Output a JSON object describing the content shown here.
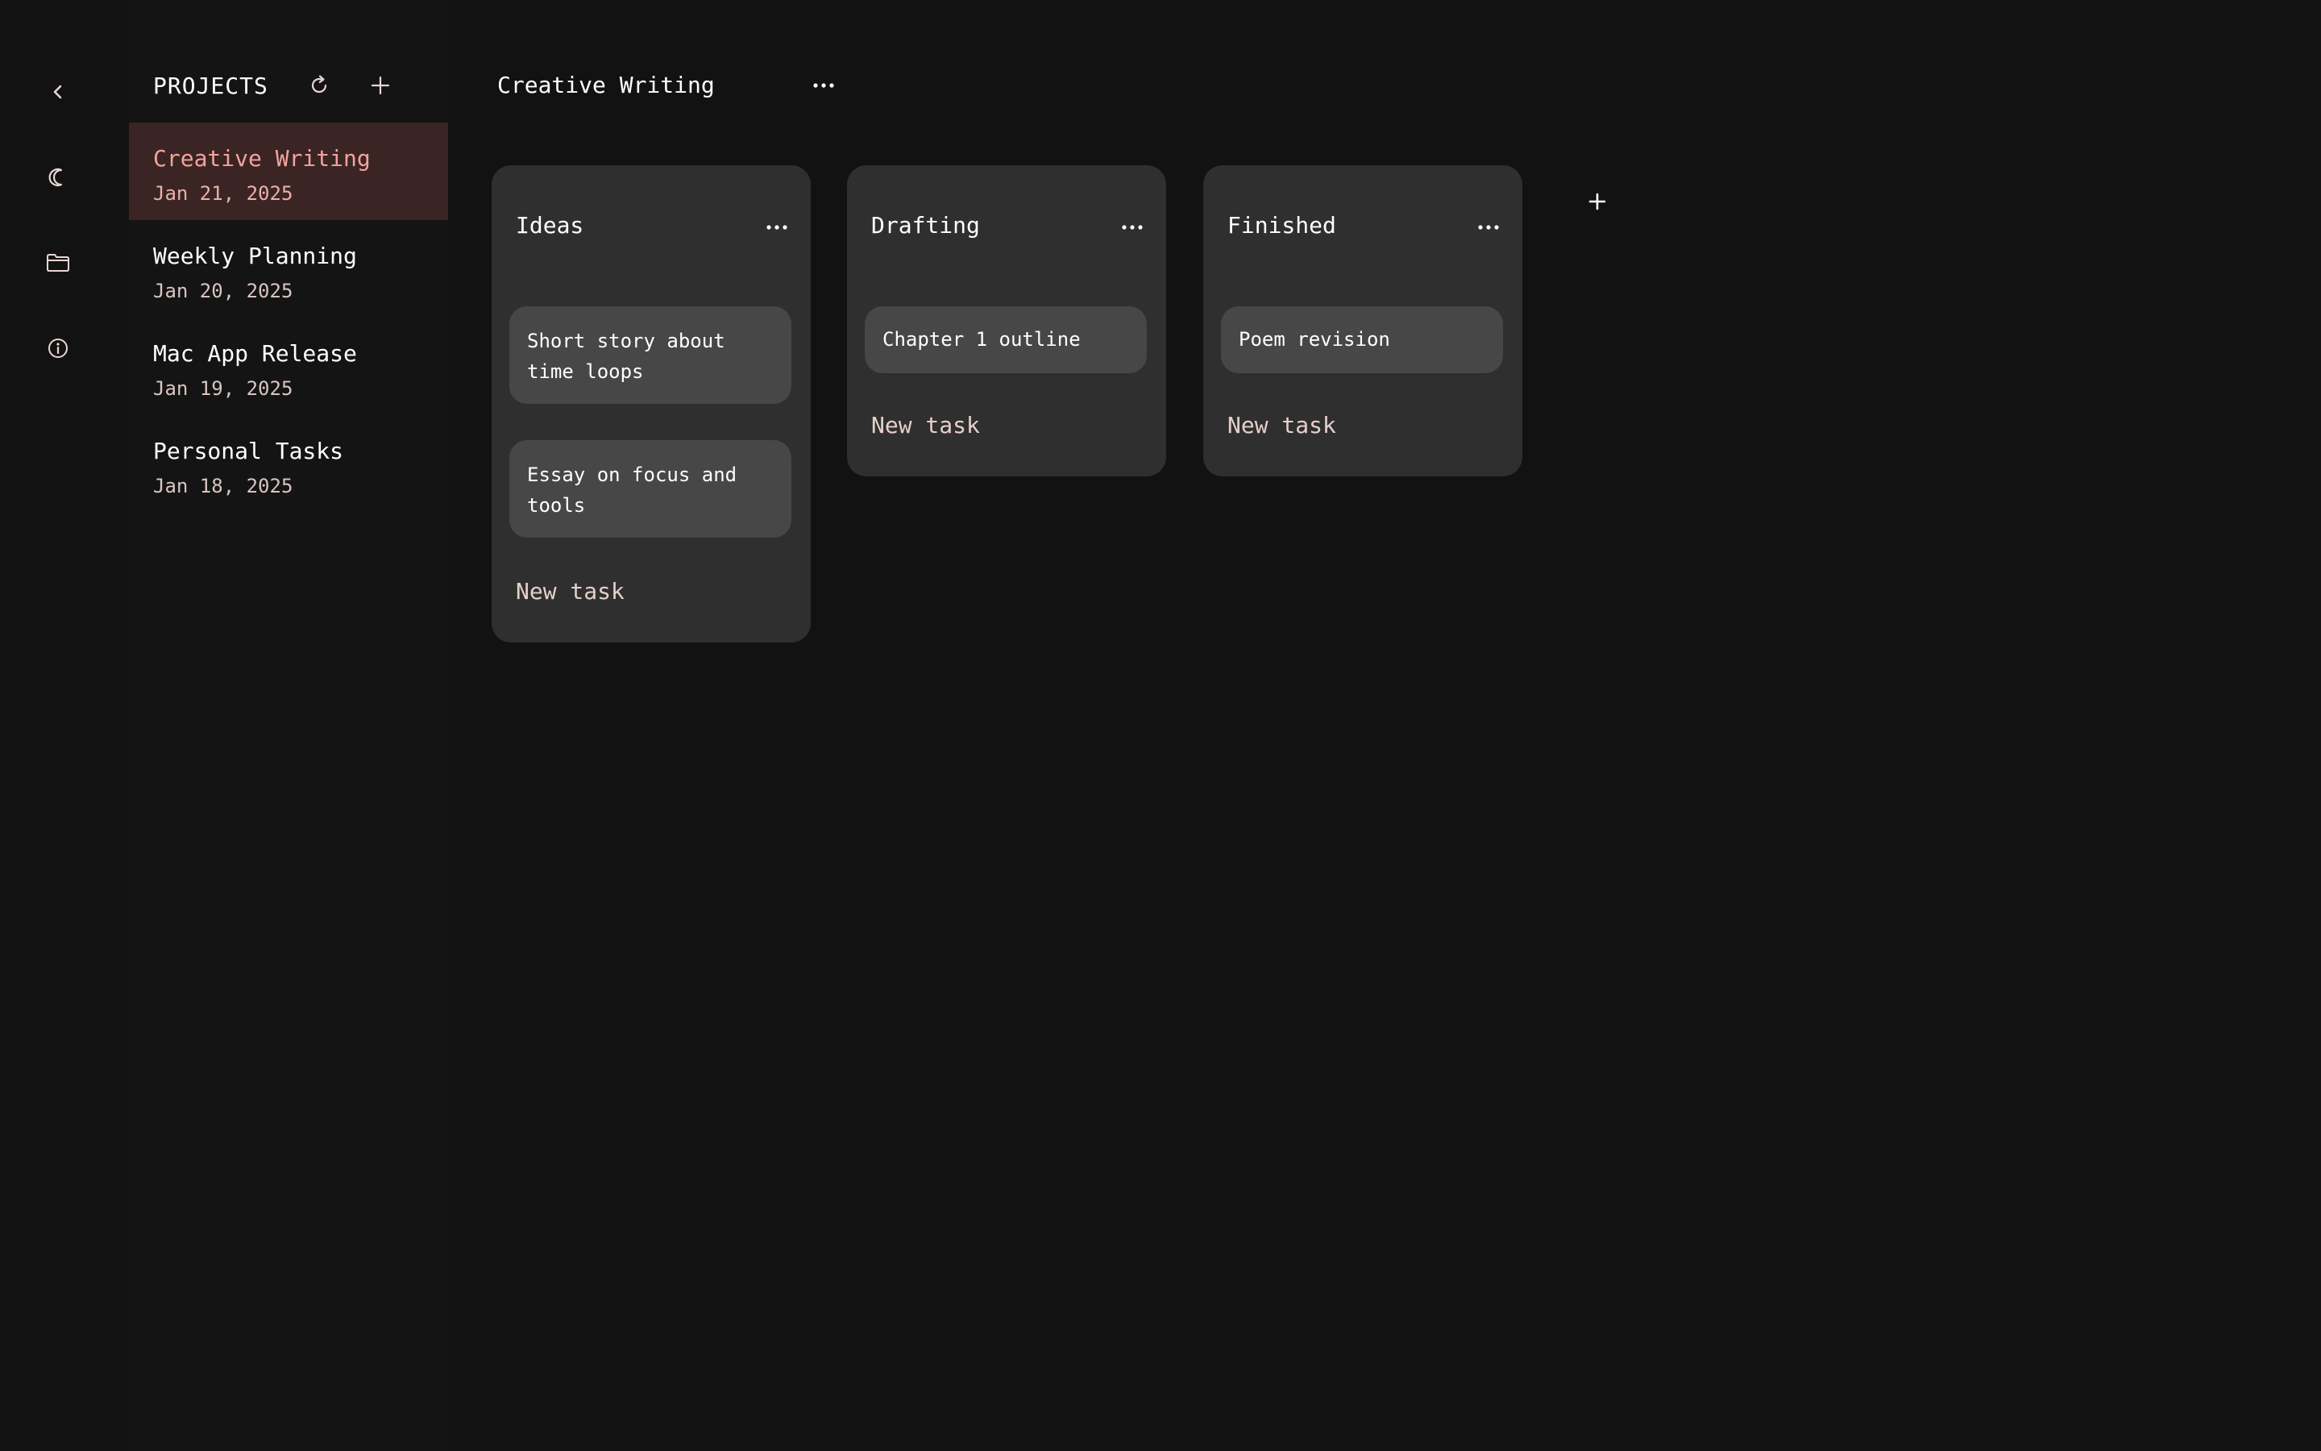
{
  "sidebar": {
    "title": "PROJECTS",
    "icons": {
      "back": "chevron-left-icon",
      "theme": "moon-icon",
      "folder": "folder-icon",
      "info": "info-icon",
      "refresh": "refresh-icon",
      "add": "plus-icon"
    },
    "projects": [
      {
        "name": "Creative Writing",
        "date": "Jan 21, 2025",
        "active": true
      },
      {
        "name": "Weekly Planning",
        "date": "Jan 20, 2025",
        "active": false
      },
      {
        "name": "Mac App Release",
        "date": "Jan 19, 2025",
        "active": false
      },
      {
        "name": "Personal Tasks",
        "date": "Jan 18, 2025",
        "active": false
      }
    ]
  },
  "board": {
    "title": "Creative Writing",
    "columns": [
      {
        "title": "Ideas",
        "cards": [
          "Short story about time loops",
          "Essay on focus and tools"
        ],
        "new_task_label": "New task"
      },
      {
        "title": "Drafting",
        "cards": [
          "Chapter 1 outline"
        ],
        "new_task_label": "New task"
      },
      {
        "title": "Finished",
        "cards": [
          "Poem revision"
        ],
        "new_task_label": "New task"
      }
    ]
  },
  "colors": {
    "background": "#121212",
    "panel": "#141414",
    "column": "#2f2f2f",
    "card": "#474747",
    "active_item": "#3b2424",
    "accent": "#f0a49c"
  }
}
